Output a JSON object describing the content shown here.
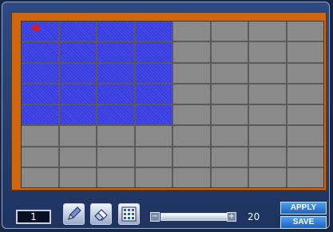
{
  "grid": {
    "columns": 8,
    "rows": 8,
    "selected": [
      [
        0,
        0
      ],
      [
        0,
        1
      ],
      [
        0,
        2
      ],
      [
        0,
        3
      ],
      [
        1,
        0
      ],
      [
        1,
        1
      ],
      [
        1,
        2
      ],
      [
        1,
        3
      ],
      [
        2,
        0
      ],
      [
        2,
        1
      ],
      [
        2,
        2
      ],
      [
        2,
        3
      ],
      [
        3,
        0
      ],
      [
        3,
        1
      ],
      [
        3,
        2
      ],
      [
        3,
        3
      ],
      [
        4,
        0
      ],
      [
        4,
        1
      ],
      [
        4,
        2
      ],
      [
        4,
        3
      ]
    ],
    "selected_color": "#3a3ee0",
    "unselected_color": "#8a8a8a",
    "frame_color": "#d0660d"
  },
  "toolbar": {
    "channel_number": "1",
    "tools": [
      "pencil-icon",
      "eraser-icon",
      "select-all-icon"
    ],
    "slider": {
      "value": "20",
      "minus_label": "−",
      "plus_label": "+"
    },
    "apply_label": "APPLY",
    "save_label": "SAVE"
  }
}
